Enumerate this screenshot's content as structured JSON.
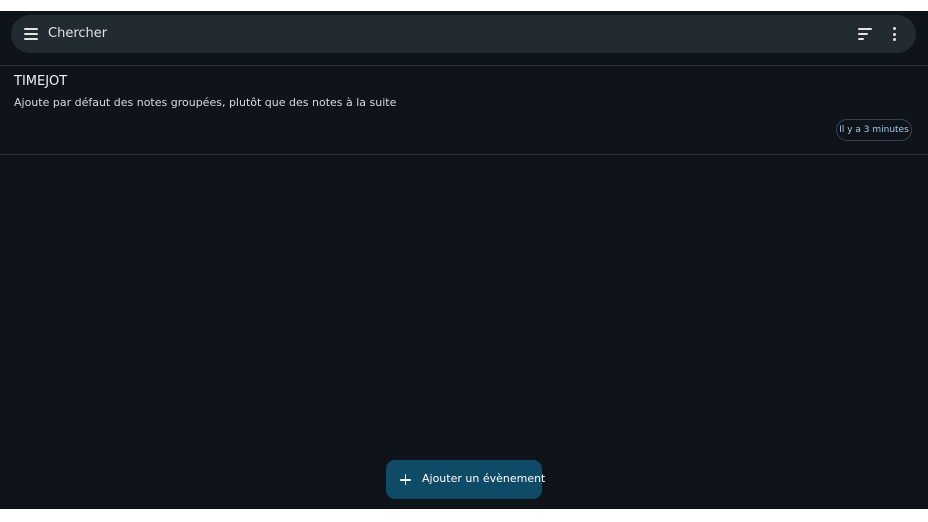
{
  "search": {
    "placeholder": "Chercher",
    "menu_icon": "menu-icon",
    "sort_icon": "sort-icon",
    "more_icon": "more-vert-icon"
  },
  "notes": [
    {
      "title": "TIMEJOT",
      "body": "Ajoute par défaut des notes groupées, plutôt que des notes à la suite",
      "time": "Il y a 3 minutes"
    }
  ],
  "fab": {
    "icon": "plus-icon",
    "label": "Ajouter un évènement"
  },
  "colors": {
    "background": "#0f141b",
    "search_bar": "#222a32",
    "fab": "#0f4a66",
    "chip_text": "#a9c8e8"
  }
}
